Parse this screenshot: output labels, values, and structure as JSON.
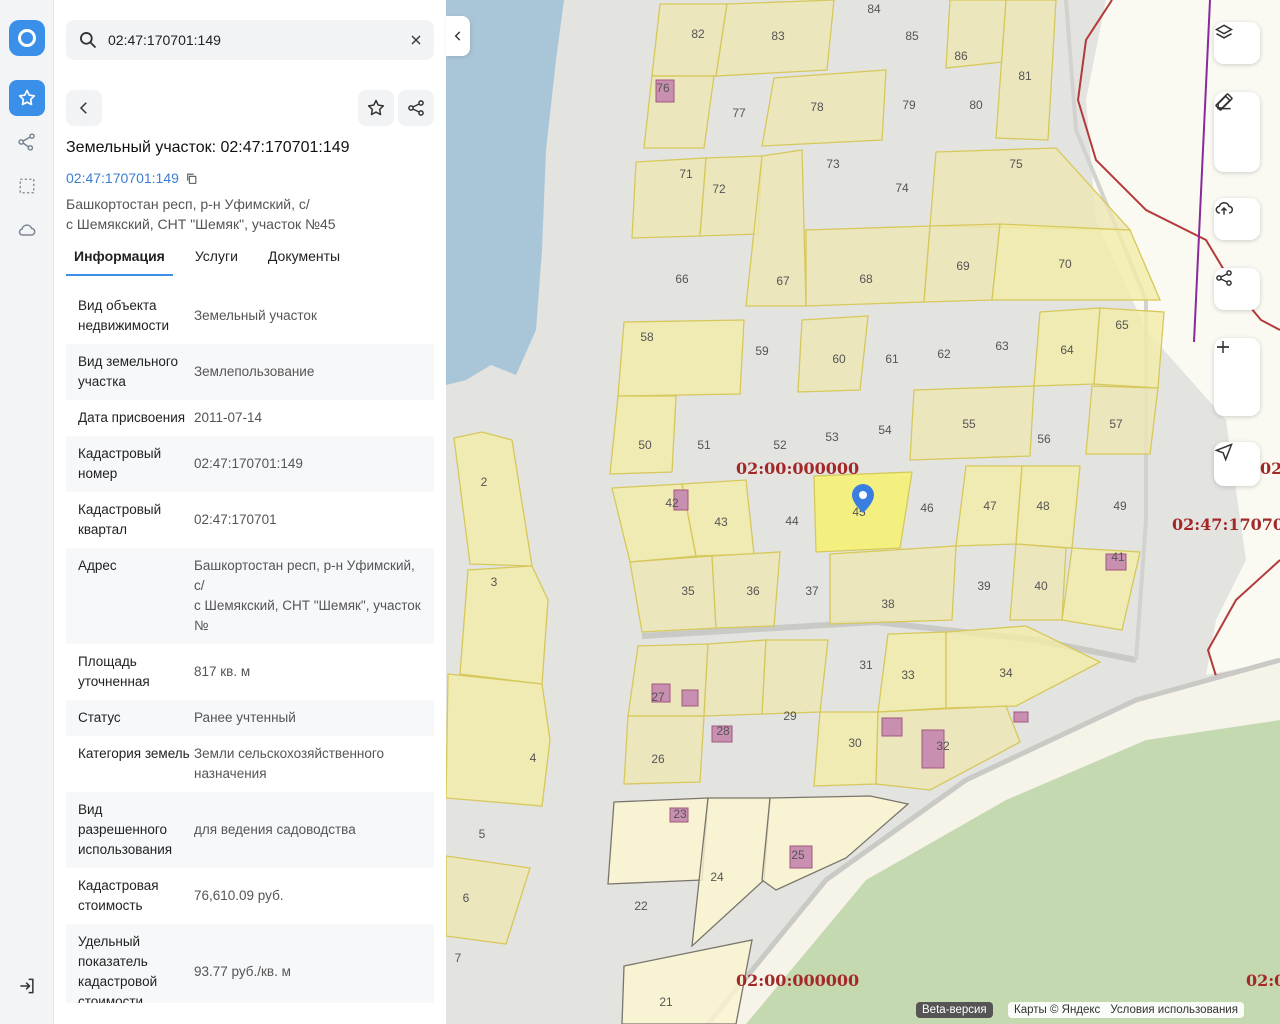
{
  "search": {
    "value": "02:47:170701:149"
  },
  "object": {
    "title": "Земельный участок: 02:47:170701:149",
    "cad_link": "02:47:170701:149",
    "address": "Башкортостан респ, р-н Уфимский, с/\nс Шемякский, СНТ \"Шемяк\", участок №45"
  },
  "tabs": [
    "Информация",
    "Услуги",
    "Документы"
  ],
  "info_rows": [
    {
      "k": "Вид объекта недвижимости",
      "v": "Земельный участок"
    },
    {
      "k": "Вид земельного участка",
      "v": "Землепользование"
    },
    {
      "k": "Дата присвоения",
      "v": "2011-07-14"
    },
    {
      "k": "Кадастровый номер",
      "v": "02:47:170701:149"
    },
    {
      "k": "Кадастровый квартал",
      "v": "02:47:170701"
    },
    {
      "k": "Адрес",
      "v": "Башкортостан респ, р-н Уфимский, с/\nс Шемякский, СНТ \"Шемяк\", участок №"
    },
    {
      "k": "Площадь уточненная",
      "v": "817 кв. м"
    },
    {
      "k": "Статус",
      "v": "Ранее учтенный"
    },
    {
      "k": "Категория земель",
      "v": "Земли сельскохозяйственного назначения"
    },
    {
      "k": "Вид разрешенного использования",
      "v": "для ведения садоводства"
    },
    {
      "k": "Кадастровая стоимость",
      "v": "76,610.09 руб."
    },
    {
      "k": "Удельный показатель кадастровой стоимости",
      "v": "93.77 руб./кв. м"
    }
  ],
  "map": {
    "district_labels": [
      "02:00:000000",
      "02:00:000000",
      "02:47:17070",
      "02:0",
      "02:0"
    ],
    "parcel_numbers": [
      "84",
      "85",
      "82",
      "83",
      "86",
      "81",
      "76",
      "77",
      "78",
      "79",
      "80",
      "73",
      "74",
      "75",
      "71",
      "72",
      "66",
      "67",
      "68",
      "69",
      "70",
      "58",
      "59",
      "60",
      "61",
      "62",
      "63",
      "64",
      "65",
      "50",
      "51",
      "52",
      "53",
      "54",
      "55",
      "56",
      "57",
      "2",
      "42",
      "43",
      "44",
      "45",
      "46",
      "47",
      "48",
      "49",
      "41",
      "3",
      "35",
      "36",
      "37",
      "38",
      "39",
      "40",
      "31",
      "33",
      "34",
      "27",
      "28",
      "29",
      "30",
      "32",
      "26",
      "4",
      "5",
      "23",
      "24",
      "25",
      "6",
      "22",
      "7",
      "21"
    ],
    "selected_parcel": "45",
    "attribution": {
      "beta": "Beta-версия",
      "copyright": "Карты © Яндекс",
      "terms": "Условия использования"
    }
  },
  "colors": {
    "accent": "#3a8fe8",
    "parcel_fill": "#eee6b4",
    "parcel_light": "#fbf6cf",
    "selected": "#f3f07a",
    "district_label": "#a42828",
    "water": "#a9c6d8",
    "forest": "#c5d9b0"
  }
}
